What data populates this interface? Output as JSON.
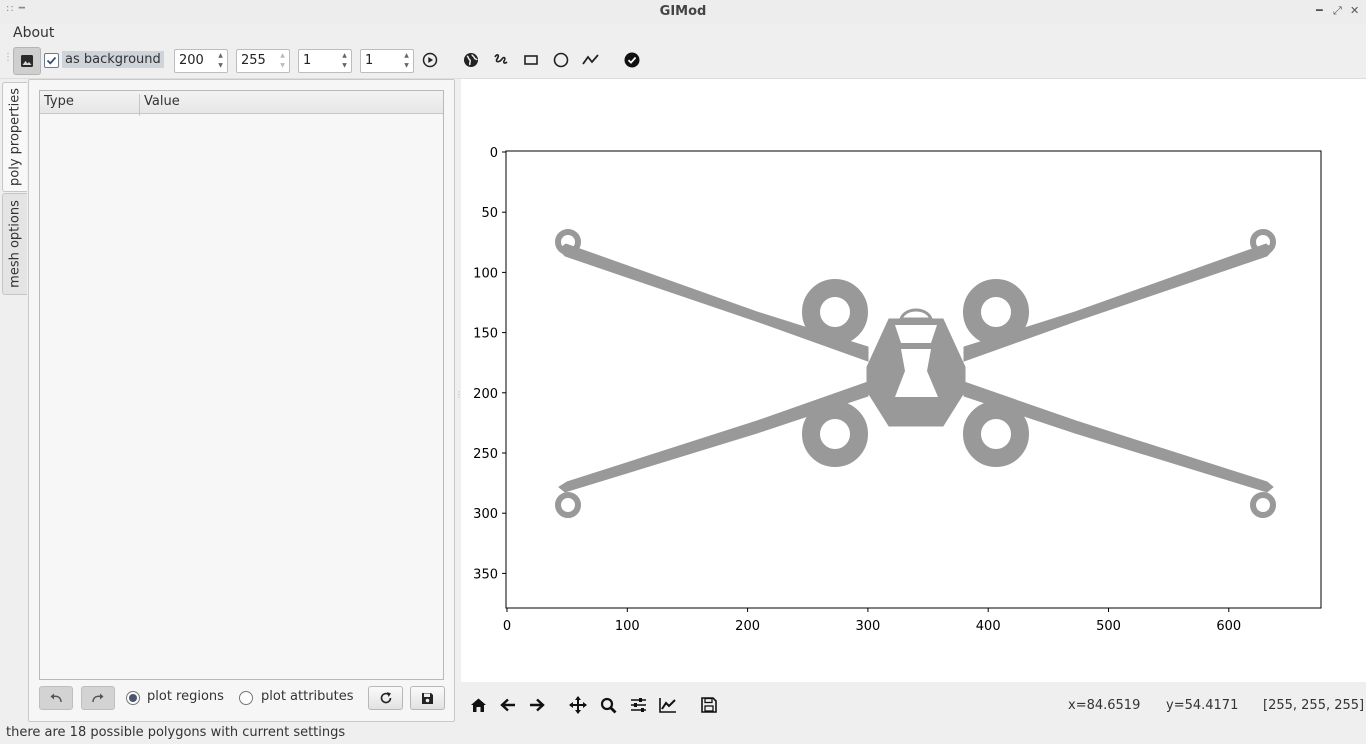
{
  "window": {
    "title": "GIMod"
  },
  "menu": {
    "about": "About"
  },
  "toolbar": {
    "background_checkbox_label": "as background",
    "spin1": "200",
    "spin2": "255",
    "spin3": "1",
    "spin4": "1"
  },
  "tabs": {
    "poly_properties": "poly properties",
    "mesh_options": "mesh options"
  },
  "table": {
    "columns": [
      "Type",
      "Value"
    ],
    "rows": []
  },
  "panel": {
    "plot_regions": "plot regions",
    "plot_attributes": "plot attributes",
    "selected_mode": "plot regions"
  },
  "plot": {
    "xticks": [
      "0",
      "100",
      "200",
      "300",
      "400",
      "500",
      "600"
    ],
    "yticks": [
      "0",
      "50",
      "100",
      "150",
      "200",
      "250",
      "300",
      "350"
    ]
  },
  "navbar": {
    "x": "x=84.6519",
    "y": "y=54.4171",
    "rgb": "[255, 255, 255]"
  },
  "status": {
    "message": "there are 18 possible polygons with current settings"
  },
  "colors": {
    "shape": "#999999",
    "window_bg": "#efefef"
  },
  "icons": [
    "image-icon",
    "play-icon",
    "globe-icon",
    "freehand-icon",
    "rectangle-icon",
    "circle-icon",
    "polyline-icon",
    "check-circle-icon",
    "undo-icon",
    "redo-icon",
    "refresh-icon",
    "save-icon",
    "home-icon",
    "back-icon",
    "forward-icon",
    "pan-icon",
    "zoom-icon",
    "configure-icon",
    "edit-curve-icon",
    "save-figure-icon"
  ]
}
